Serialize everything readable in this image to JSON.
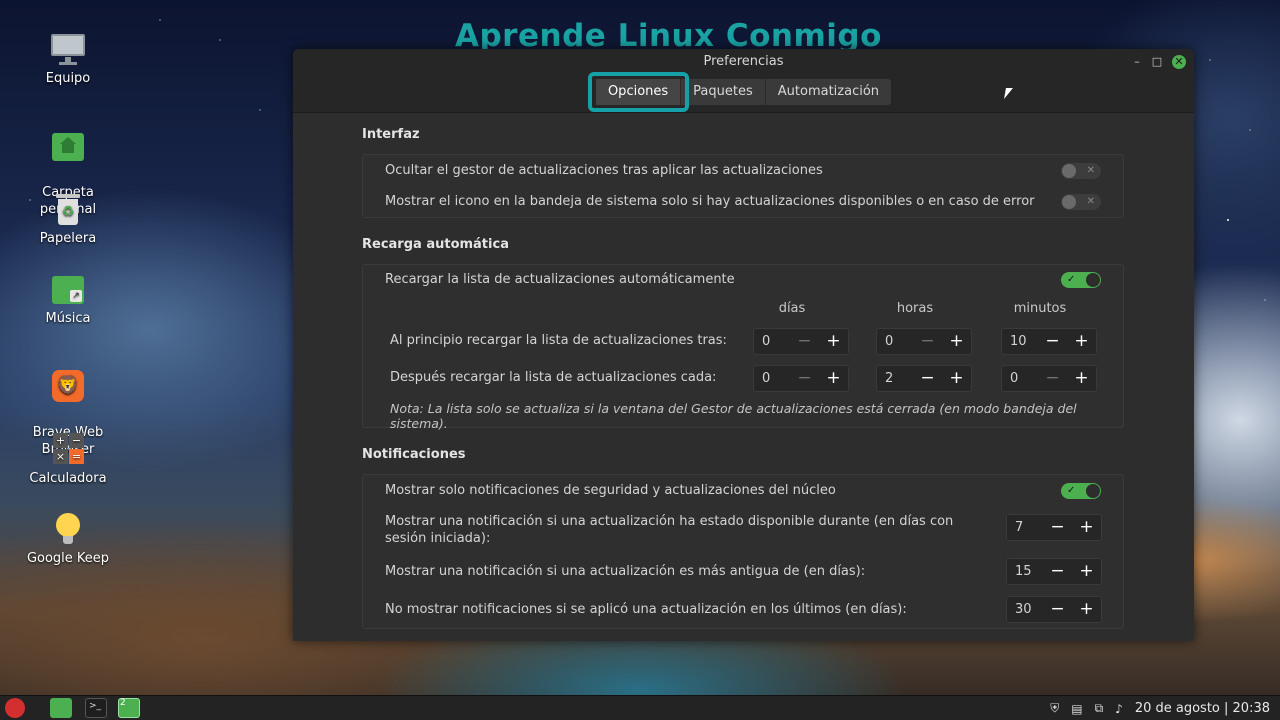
{
  "watermark": "Aprende Linux Conmigo",
  "desktop": {
    "icons": [
      {
        "label": "Equipo",
        "icon": "computer-icon"
      },
      {
        "label": "Carpeta\npersonal",
        "icon": "home-folder-icon"
      },
      {
        "label": "Papelera",
        "icon": "trash-icon"
      },
      {
        "label": "Música",
        "icon": "music-folder-icon"
      },
      {
        "label": "Brave Web\nBrowser",
        "icon": "brave-icon"
      },
      {
        "label": "Calculadora",
        "icon": "calculator-icon"
      },
      {
        "label": "Google Keep",
        "icon": "keep-icon"
      }
    ]
  },
  "window": {
    "title": "Preferencias",
    "controls": {
      "minimize": "–",
      "maximize": "□",
      "close": "✕"
    },
    "tabs": [
      {
        "label": "Opciones",
        "active": true
      },
      {
        "label": "Paquetes",
        "active": false
      },
      {
        "label": "Automatización",
        "active": false
      }
    ]
  },
  "interfaz": {
    "title": "Interfaz",
    "rows": [
      {
        "label": "Ocultar el gestor de actualizaciones tras aplicar las actualizaciones",
        "on": false
      },
      {
        "label": "Mostrar el icono en la bandeja de sistema solo si hay actualizaciones disponibles o en caso de error",
        "on": false
      }
    ]
  },
  "recarga": {
    "title": "Recarga automática",
    "toggle_label": "Recargar la lista de actualizaciones automáticamente",
    "toggle_on": true,
    "columns": [
      "días",
      "horas",
      "minutos"
    ],
    "first_label": "Al principio recargar la lista de actualizaciones tras:",
    "first_values": [
      "0",
      "0",
      "10"
    ],
    "after_label": "Después recargar la lista de actualizaciones cada:",
    "after_values": [
      "0",
      "2",
      "0"
    ],
    "note": "Nota: La lista solo se actualiza si la ventana del Gestor de actualizaciones está cerrada (en modo bandeja del sistema)."
  },
  "notificaciones": {
    "title": "Notificaciones",
    "toggle_label": "Mostrar solo notificaciones de seguridad y actualizaciones del núcleo",
    "toggle_on": true,
    "rows": [
      {
        "label": "Mostrar una notificación si una actualización ha estado disponible durante (en días con sesión iniciada):",
        "value": "7"
      },
      {
        "label": "Mostrar una notificación si una actualización es más antigua de (en días):",
        "value": "15"
      },
      {
        "label": "No mostrar notificaciones si se aplicó una actualización en los últimos (en días):",
        "value": "30"
      }
    ]
  },
  "spin": {
    "minus": "−",
    "plus": "+"
  },
  "taskbar": {
    "workspace_badge": "2",
    "clock": "20 de agosto | 20:38"
  },
  "colors": {
    "accent": "#4caf50",
    "highlight": "#16a1a8"
  }
}
